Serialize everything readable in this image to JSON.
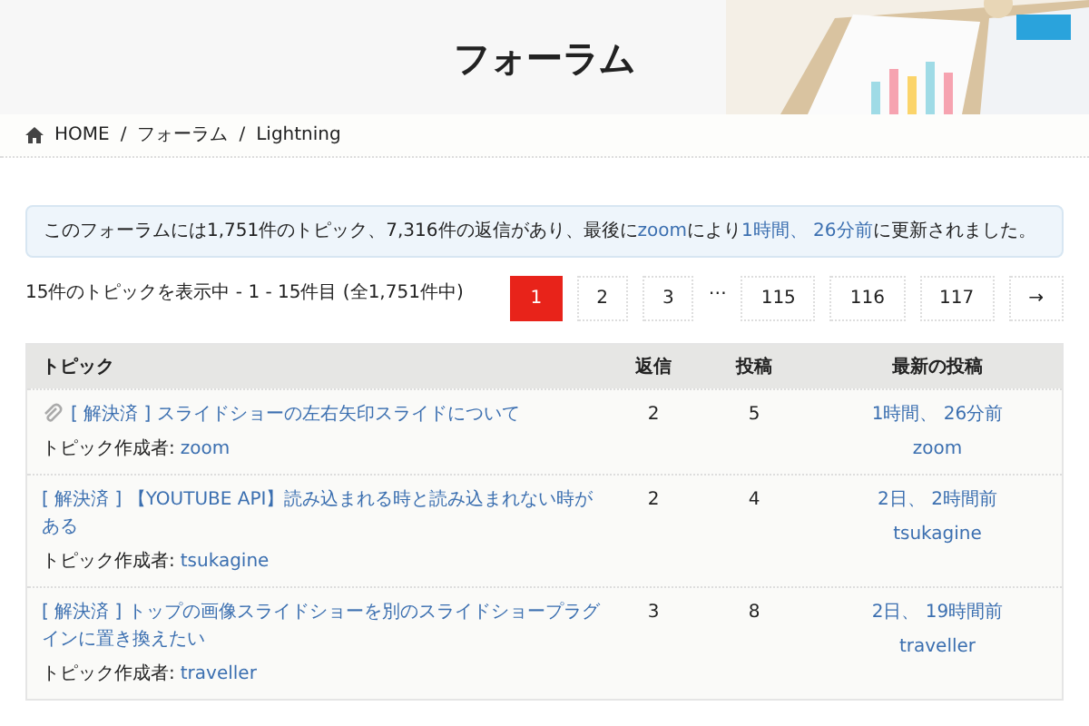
{
  "header": {
    "title": "フォーラム"
  },
  "breadcrumb": [
    {
      "label": "HOME",
      "kind": "home"
    },
    {
      "label": "フォーラム",
      "kind": "link",
      "separator": "/"
    },
    {
      "label": "Lightning",
      "kind": "current",
      "separator": "/"
    }
  ],
  "notice": [
    {
      "text": "このフォーラムには1,751件のトピック、7,316件の返信があり、最後に",
      "kind": "text"
    },
    {
      "text": "zoom",
      "kind": "link"
    },
    {
      "text": "により",
      "kind": "text"
    },
    {
      "text": "1時間、 26分前",
      "kind": "link"
    },
    {
      "text": "に更新されました。",
      "kind": "text"
    }
  ],
  "summary": "15件のトピックを表示中 - 1 - 15件目 (全1,751件中)",
  "pagination": [
    {
      "label": "1",
      "kind": "page",
      "selected": true
    },
    {
      "label": "2",
      "kind": "page",
      "selected": false
    },
    {
      "label": "3",
      "kind": "page",
      "selected": false
    },
    {
      "label": "…",
      "kind": "gap"
    },
    {
      "label": "115",
      "kind": "page",
      "selected": false
    },
    {
      "label": "116",
      "kind": "page",
      "selected": false
    },
    {
      "label": "117",
      "kind": "page",
      "selected": false
    },
    {
      "label": "→",
      "kind": "page",
      "selected": false
    }
  ],
  "table": {
    "columns": [
      "トピック",
      "返信",
      "投稿",
      "最新の投稿"
    ],
    "rows": [
      {
        "attachment": true,
        "title": "[ 解決済 ] スライドショーの左右矢印スライドについて",
        "author_label": "トピック作成者:",
        "author": "zoom",
        "replies": "2",
        "posts": "5",
        "last_time": "1時間、 26分前",
        "last_user": "zoom"
      },
      {
        "attachment": false,
        "title": "[ 解決済 ] 【YOUTUBE API】読み込まれる時と読み込まれない時がある",
        "author_label": "トピック作成者:",
        "author": "tsukagine",
        "replies": "2",
        "posts": "4",
        "last_time": "2日、 2時間前",
        "last_user": "tsukagine"
      },
      {
        "attachment": false,
        "title": "[ 解決済 ] トップの画像スライドショーを別のスライドショープラグインに置き換えたい",
        "author_label": "トピック作成者:",
        "author": "traveller",
        "replies": "3",
        "posts": "8",
        "last_time": "2日、 19時間前",
        "last_user": "traveller"
      }
    ]
  }
}
